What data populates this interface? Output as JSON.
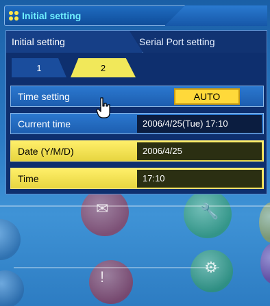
{
  "window": {
    "title": "Initial setting"
  },
  "tabs": {
    "active": "Initial setting",
    "inactive": "Serial Port setting"
  },
  "subtabs": [
    "1",
    "2"
  ],
  "rows": {
    "time_setting": {
      "label": "Time setting",
      "button": "AUTO"
    },
    "current_time": {
      "label": "Current time",
      "value": "2006/4/25(Tue) 17:10"
    },
    "date": {
      "label": "Date (Y/M/D)",
      "value": "2006/4/25"
    },
    "time": {
      "label": "Time",
      "value": "17:10"
    }
  },
  "colors": {
    "title_text": "#6ff0ff",
    "accent_yellow": "#f1e85a",
    "panel_bg": "#0e2f6e",
    "row_blue": "#1d5eb0"
  },
  "icons": [
    "grid-dots-icon",
    "hand-cursor-icon"
  ]
}
